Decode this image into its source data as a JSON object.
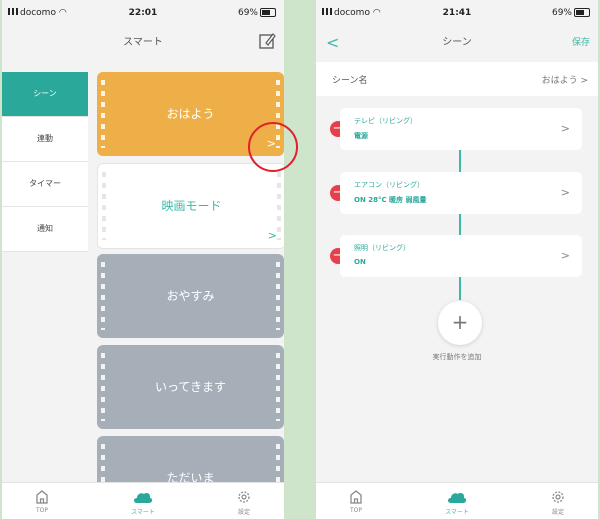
{
  "left": {
    "status": {
      "carrier": "docomo",
      "time": "22:01",
      "battery": "69%"
    },
    "title": "スマート",
    "sidebar": [
      {
        "label": "シーン",
        "active": true
      },
      {
        "label": "連動"
      },
      {
        "label": "タイマー"
      },
      {
        "label": "通知"
      }
    ],
    "cards": [
      {
        "label": "おはよう",
        "style": "orange"
      },
      {
        "label": "映画モード",
        "style": "white"
      },
      {
        "label": "おやすみ",
        "style": "gray"
      },
      {
        "label": "いってきます",
        "style": "gray"
      },
      {
        "label": "ただいま",
        "style": "gray"
      }
    ]
  },
  "right": {
    "status": {
      "carrier": "docomo",
      "time": "21:41",
      "battery": "69%"
    },
    "title": "シーン",
    "save": "保存",
    "scene_name": {
      "label": "シーン名",
      "value": "おはよう"
    },
    "actions": [
      {
        "name": "テレビ（リビング）",
        "desc": "電源"
      },
      {
        "name": "エアコン（リビング）",
        "desc": "ON 28°C 暖房 弱風量"
      },
      {
        "name": "照明（リビング）",
        "desc": "ON"
      }
    ],
    "add_label": "実行動作を追加"
  },
  "tabbar": {
    "top": "TOP",
    "smart": "スマート",
    "settings": "設定"
  },
  "colors": {
    "accent": "#3fb8a8",
    "orange": "#efaf48",
    "gray_card": "#a6aeb8",
    "delete": "#e5404b",
    "highlight": "#e0202a"
  }
}
